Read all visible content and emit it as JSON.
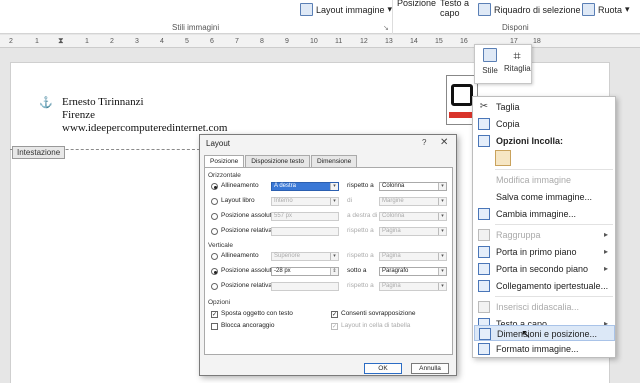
{
  "ribbon": {
    "stili_immagini": "Stili immagini",
    "disponi": "Disponi",
    "layout_immagine": "Layout immagine",
    "posizione": "Posizione",
    "testo_a": "Testo a",
    "capo": "capo",
    "riquadro": "Riquadro di selezione",
    "ruota": "Ruota"
  },
  "ruler": [
    "2",
    "1",
    "1",
    "2",
    "3",
    "4",
    "5",
    "6",
    "7",
    "8",
    "9",
    "10",
    "11",
    "12",
    "13",
    "14",
    "15",
    "16",
    "17",
    "18"
  ],
  "document": {
    "line1": "Ernesto Tirinnanzi",
    "line2": "Firenze",
    "line3": "www.ideepercomputeredinternet.com",
    "header_tag": "Intestazione"
  },
  "minibar": {
    "stile": "Stile",
    "ritaglia": "Ritaglia"
  },
  "dialog": {
    "title": "Layout",
    "help": "?",
    "close": "✕",
    "tabs": [
      "Posizione",
      "Disposizione testo",
      "Dimensione"
    ],
    "orizzontale": "Orizzontale",
    "allineamento": "Allineamento",
    "allineamento_val": "A destra",
    "rispetto_a": "rispetto a",
    "colonna": "Colonna",
    "layout_libro": "Layout libro",
    "interno": "Interno",
    "di": "di",
    "margine": "Margine",
    "posizione_assoluta": "Posizione assoluta",
    "pos_ass_h_val": "557 px",
    "a_destra_di": "a destra di",
    "colonna2": "Colonna",
    "posizione_relativa": "Posizione relativa",
    "pagina": "Pagina",
    "verticale": "Verticale",
    "v_allineamento": "Allineamento",
    "superiore": "Superiore",
    "pagina2": "Pagina",
    "v_pos_ass_val": "-28 px",
    "sotto_a": "sotto a",
    "paragrafo": "Paragrafo",
    "pagina3": "Pagina",
    "opzioni": "Opzioni",
    "sposta": "Sposta oggetto con testo",
    "blocca": "Blocca ancoraggio",
    "consenti": "Consenti sovrapposizione",
    "layout_cella": "Layout in cella di tabella",
    "ok": "OK",
    "annulla": "Annulla"
  },
  "context_menu": {
    "taglia": "Taglia",
    "copia": "Copia",
    "opzioni_incolla": "Opzioni Incolla:",
    "modifica": "Modifica immagine",
    "salva": "Salva come immagine...",
    "cambia": "Cambia immagine...",
    "raggruppa": "Raggruppa",
    "primo_piano": "Porta in primo piano",
    "secondo_piano": "Porta in secondo piano",
    "collegamento": "Collegamento ipertestuale...",
    "didascalia": "Inserisci didascalia...",
    "testo_capo": "Testo a capo",
    "dimensioni": "Dimensioni e posizione...",
    "formato": "Formato immagine..."
  }
}
